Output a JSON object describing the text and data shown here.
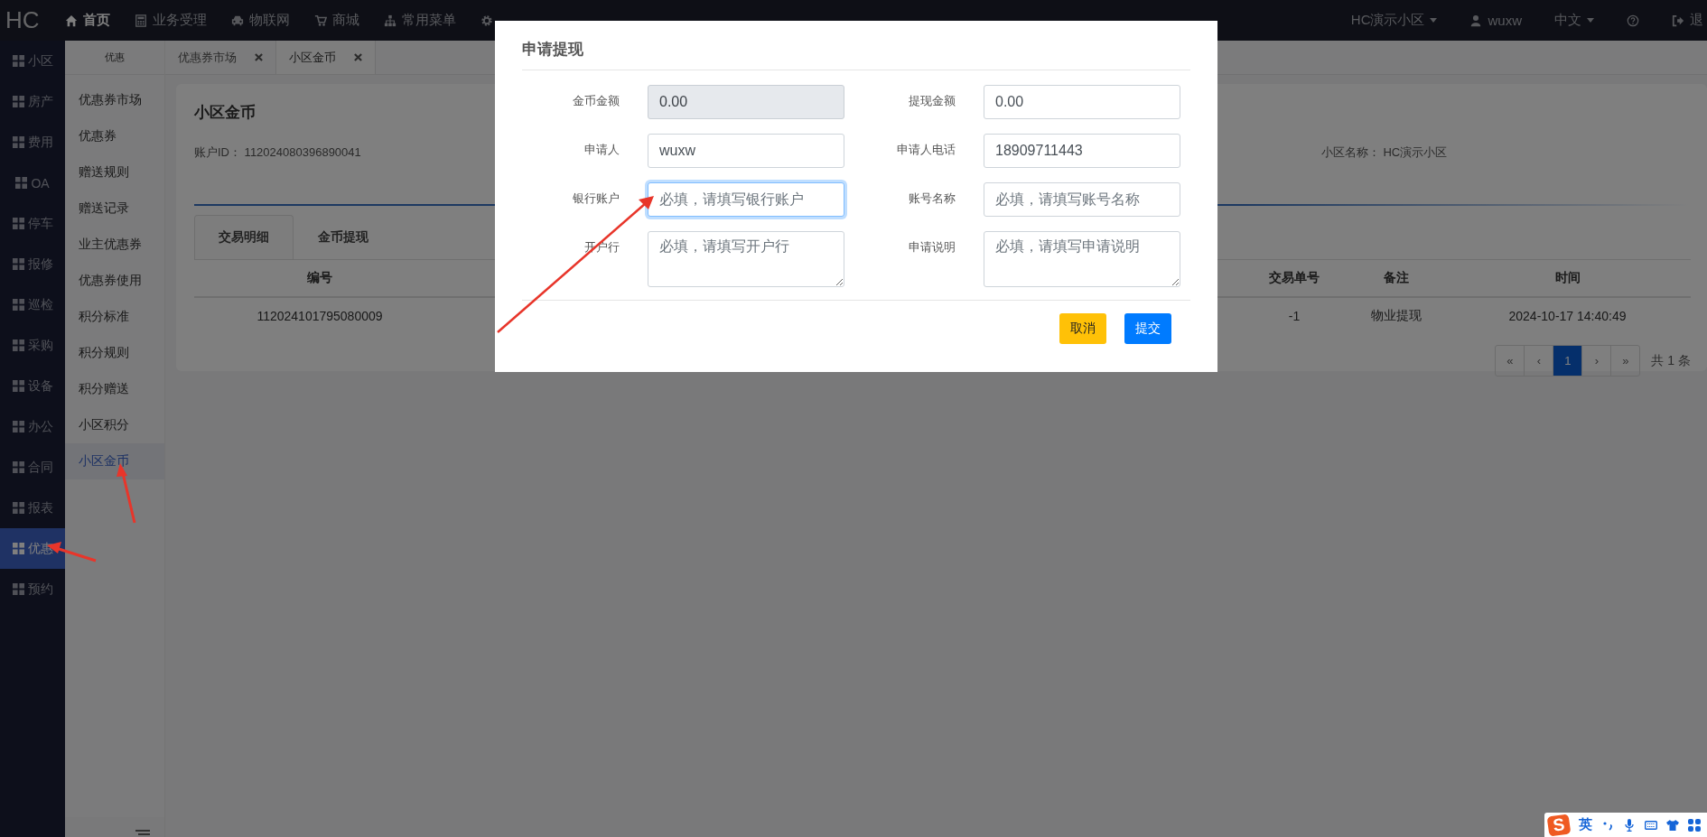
{
  "topbar": {
    "logo": "HC",
    "menu": [
      {
        "label": "首页",
        "selected": true
      },
      {
        "label": "业务受理",
        "selected": false
      },
      {
        "label": "物联网",
        "selected": false
      },
      {
        "label": "商城",
        "selected": false
      },
      {
        "label": "常用菜单",
        "selected": false
      },
      {
        "selected": false
      }
    ],
    "community": "HC演示小区",
    "user": "wuxw",
    "language": "中文",
    "logout": "退"
  },
  "sidebar": {
    "items": [
      {
        "label": "小区",
        "selected": false
      },
      {
        "label": "房产",
        "selected": false
      },
      {
        "label": "费用",
        "selected": false
      },
      {
        "label": "OA",
        "selected": false
      },
      {
        "label": "停车",
        "selected": false
      },
      {
        "label": "报修",
        "selected": false
      },
      {
        "label": "巡检",
        "selected": false
      },
      {
        "label": "采购",
        "selected": false
      },
      {
        "label": "设备",
        "selected": false
      },
      {
        "label": "办公",
        "selected": false
      },
      {
        "label": "合同",
        "selected": false
      },
      {
        "label": "报表",
        "selected": false
      },
      {
        "label": "优惠",
        "selected": true
      },
      {
        "label": "预约",
        "selected": false
      }
    ]
  },
  "submenu": {
    "title": "优惠",
    "items": [
      {
        "label": "优惠券市场",
        "selected": false
      },
      {
        "label": "优惠券",
        "selected": false
      },
      {
        "label": "赠送规则",
        "selected": false
      },
      {
        "label": "赠送记录",
        "selected": false
      },
      {
        "label": "业主优惠券",
        "selected": false
      },
      {
        "label": "优惠券使用",
        "selected": false
      },
      {
        "label": "积分标准",
        "selected": false
      },
      {
        "label": "积分规则",
        "selected": false
      },
      {
        "label": "积分赠送",
        "selected": false
      },
      {
        "label": "小区积分",
        "selected": false
      },
      {
        "label": "小区金币",
        "selected": true
      }
    ]
  },
  "tabs": [
    {
      "label": "优惠券市场",
      "selected": false
    },
    {
      "label": "小区金币",
      "selected": true
    }
  ],
  "card": {
    "title": "小区金币",
    "account_id": {
      "label": "账户ID：",
      "value": "112024080396890041"
    },
    "community_name": {
      "label": "小区名称：",
      "value": "HC演示小区"
    },
    "tabs": [
      {
        "label": "交易明细",
        "selected": true
      },
      {
        "label": "金币提现",
        "selected": false
      }
    ],
    "table": {
      "columns": [
        "编号",
        "交易单号",
        "备注",
        "时间"
      ],
      "rows": [
        [
          "112024101795080009",
          "-1",
          "物业提现",
          "2024-10-17 14:40:49"
        ]
      ]
    },
    "pagination": {
      "pages": [
        {
          "label": "«",
          "selected": false
        },
        {
          "label": "‹",
          "selected": false
        },
        {
          "label": "1",
          "selected": true
        },
        {
          "label": "›",
          "selected": false
        },
        {
          "label": "»",
          "selected": false
        }
      ],
      "total": "共 1 条"
    }
  },
  "modal": {
    "title": "申请提现",
    "fields": [
      {
        "label": "金币金额",
        "kind": "input",
        "value": "0.00",
        "readonly": true,
        "focused": false
      },
      {
        "label": "提现金额",
        "kind": "input",
        "value": "0.00",
        "readonly": false,
        "focused": false
      },
      {
        "label": "申请人",
        "kind": "input",
        "value": "wuxw",
        "readonly": false,
        "focused": false
      },
      {
        "label": "申请人电话",
        "kind": "input",
        "value": "18909711443",
        "readonly": false,
        "focused": false
      },
      {
        "label": "银行账户",
        "kind": "input",
        "placeholder": "必填，请填写银行账户",
        "readonly": false,
        "focused": true
      },
      {
        "label": "账号名称",
        "kind": "input",
        "placeholder": "必填，请填写账号名称",
        "readonly": false,
        "focused": false
      },
      {
        "label": "开户行",
        "kind": "textarea",
        "placeholder": "必填，请填写开户行",
        "readonly": false,
        "focused": false
      },
      {
        "label": "申请说明",
        "kind": "textarea",
        "placeholder": "必填，请填写申请说明",
        "readonly": false,
        "focused": false
      }
    ],
    "buttons": [
      {
        "label": "取消",
        "kind": "cancel"
      },
      {
        "label": "提交",
        "kind": "submit"
      }
    ]
  },
  "ime": {
    "logo": "S",
    "mode": "英"
  }
}
